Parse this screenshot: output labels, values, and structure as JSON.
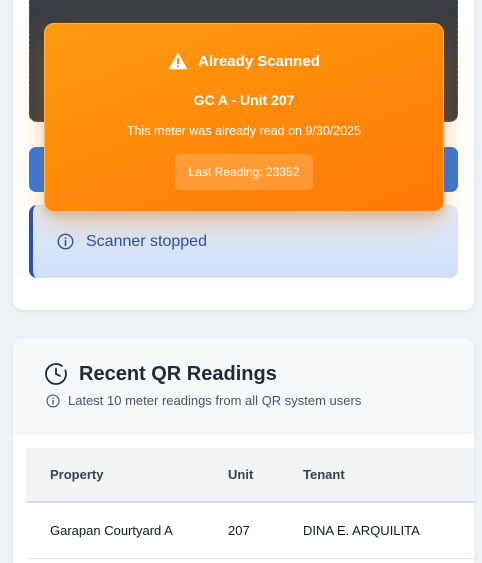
{
  "toast": {
    "title": "Already Scanned",
    "unit": "GC A - Unit 207",
    "message": "This meter was already read on 9/30/2025",
    "last_reading": "Last Reading: 23352",
    "icon": "warning-icon",
    "color": "#ff8c0a"
  },
  "scanner": {
    "status_text": "Scanner stopped",
    "status_icon": "info-icon",
    "button_color": "#2f76e0"
  },
  "recent": {
    "title": "Recent QR Readings",
    "subtitle": "Latest 10 meter readings from all QR system users",
    "title_icon": "clock-icon",
    "columns": [
      "Property",
      "Unit",
      "Tenant"
    ],
    "rows": [
      [
        "Garapan Courtyard A",
        "207",
        "DINA E. ARQUILITA"
      ]
    ]
  }
}
